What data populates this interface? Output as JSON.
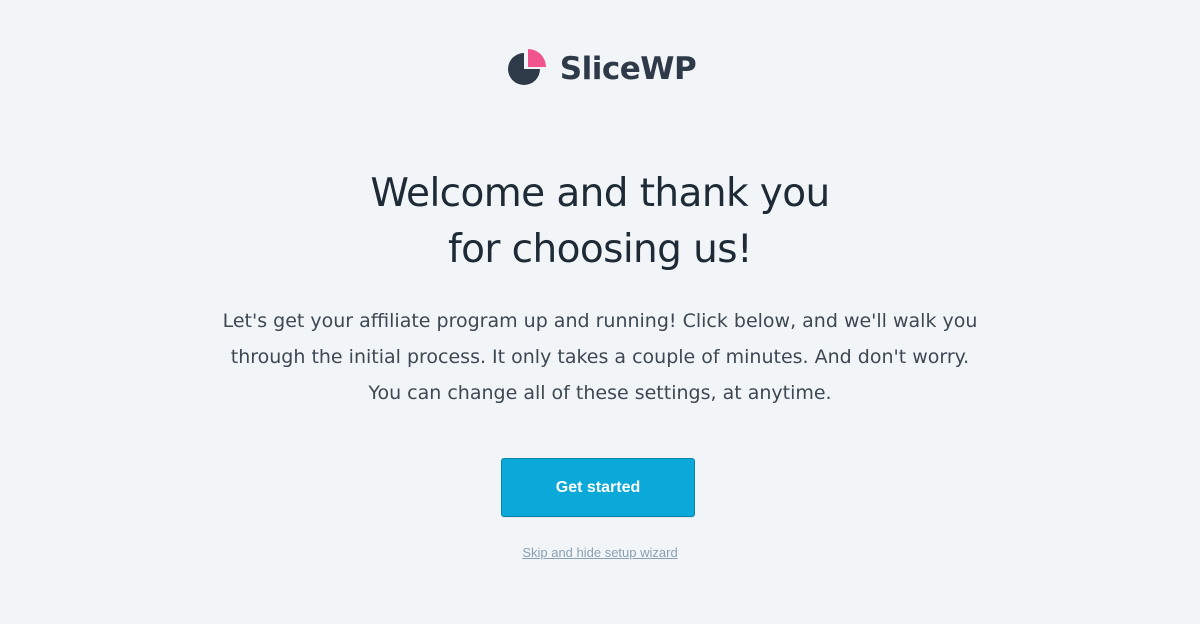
{
  "brand": {
    "name": "SliceWP",
    "colors": {
      "pie_dark": "#2e3a48",
      "pie_slice": "#f0558c"
    }
  },
  "welcome": {
    "title_line1": "Welcome and thank you",
    "title_line2": "for choosing us!",
    "intro_line1": "Let's get your affiliate program up and running! Click below, and we'll walk you",
    "intro_line2": "through the initial process. It only takes a couple of minutes. And don't worry.",
    "intro_line3": "You can change all of these settings, at anytime."
  },
  "actions": {
    "get_started_label": "Get started",
    "skip_label": "Skip and hide setup wizard"
  },
  "colors": {
    "background": "#f2f5f8",
    "button": "#0aa9d9",
    "link": "#8aa0b0"
  }
}
